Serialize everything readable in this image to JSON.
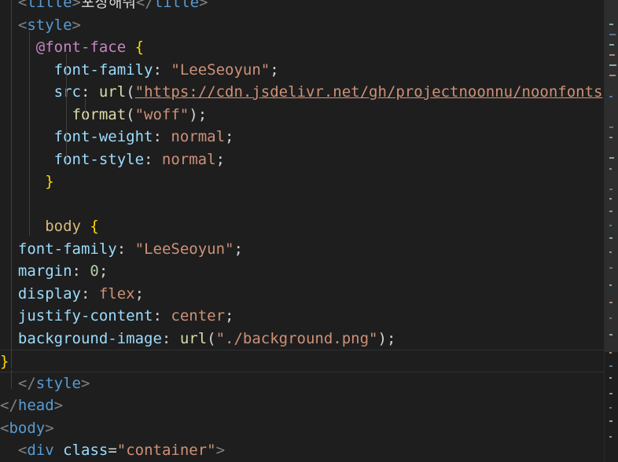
{
  "editor": {
    "lines": [
      {
        "tokens": [
          {
            "t": "  ",
            "c": "punct"
          },
          {
            "t": "<",
            "c": "angle"
          },
          {
            "t": "title",
            "c": "tag"
          },
          {
            "t": ">",
            "c": "angle"
          },
          {
            "t": "포장해줘",
            "c": "punct"
          },
          {
            "t": "</",
            "c": "angle"
          },
          {
            "t": "title",
            "c": "tag"
          },
          {
            "t": ">",
            "c": "angle"
          }
        ]
      },
      {
        "tokens": [
          {
            "t": "  ",
            "c": "punct"
          },
          {
            "t": "<",
            "c": "angle"
          },
          {
            "t": "style",
            "c": "tag"
          },
          {
            "t": ">",
            "c": "angle"
          }
        ]
      },
      {
        "tokens": [
          {
            "t": "    ",
            "c": "punct"
          },
          {
            "t": "@font-face",
            "c": "at"
          },
          {
            "t": " ",
            "c": "punct"
          },
          {
            "t": "{",
            "c": "bracket"
          }
        ]
      },
      {
        "tokens": [
          {
            "t": "      ",
            "c": "punct"
          },
          {
            "t": "font-family",
            "c": "prop"
          },
          {
            "t": ": ",
            "c": "punct"
          },
          {
            "t": "\"LeeSeoyun\"",
            "c": "str"
          },
          {
            "t": ";",
            "c": "punct"
          }
        ]
      },
      {
        "tokens": [
          {
            "t": "      ",
            "c": "punct"
          },
          {
            "t": "src",
            "c": "prop"
          },
          {
            "t": ": ",
            "c": "punct"
          },
          {
            "t": "url",
            "c": "fn"
          },
          {
            "t": "(",
            "c": "punct"
          },
          {
            "t": "\"https://cdn.jsdelivr.net/gh/projectnoonnu/noonfonts",
            "c": "url"
          }
        ]
      },
      {
        "tokens": [
          {
            "t": "        ",
            "c": "punct"
          },
          {
            "t": "format",
            "c": "fn"
          },
          {
            "t": "(",
            "c": "punct"
          },
          {
            "t": "\"woff\"",
            "c": "str"
          },
          {
            "t": ");",
            "c": "punct"
          }
        ]
      },
      {
        "tokens": [
          {
            "t": "      ",
            "c": "punct"
          },
          {
            "t": "font-weight",
            "c": "prop"
          },
          {
            "t": ": ",
            "c": "punct"
          },
          {
            "t": "normal",
            "c": "str"
          },
          {
            "t": ";",
            "c": "punct"
          }
        ]
      },
      {
        "tokens": [
          {
            "t": "      ",
            "c": "punct"
          },
          {
            "t": "font-style",
            "c": "prop"
          },
          {
            "t": ": ",
            "c": "punct"
          },
          {
            "t": "normal",
            "c": "str"
          },
          {
            "t": ";",
            "c": "punct"
          }
        ]
      },
      {
        "tokens": [
          {
            "t": "     ",
            "c": "punct"
          },
          {
            "t": "}",
            "c": "bracket"
          }
        ]
      },
      {
        "tokens": [
          {
            "t": "",
            "c": "punct"
          }
        ]
      },
      {
        "tokens": [
          {
            "t": "     ",
            "c": "punct"
          },
          {
            "t": "body",
            "c": "sel"
          },
          {
            "t": " ",
            "c": "punct"
          },
          {
            "t": "{",
            "c": "bracket"
          }
        ]
      },
      {
        "tokens": [
          {
            "t": "  ",
            "c": "punct"
          },
          {
            "t": "font-family",
            "c": "prop"
          },
          {
            "t": ": ",
            "c": "punct"
          },
          {
            "t": "\"LeeSeoyun\"",
            "c": "str"
          },
          {
            "t": ";",
            "c": "punct"
          }
        ]
      },
      {
        "tokens": [
          {
            "t": "  ",
            "c": "punct"
          },
          {
            "t": "margin",
            "c": "prop"
          },
          {
            "t": ": ",
            "c": "punct"
          },
          {
            "t": "0",
            "c": "num"
          },
          {
            "t": ";",
            "c": "punct"
          }
        ]
      },
      {
        "tokens": [
          {
            "t": "  ",
            "c": "punct"
          },
          {
            "t": "display",
            "c": "prop"
          },
          {
            "t": ": ",
            "c": "punct"
          },
          {
            "t": "flex",
            "c": "str"
          },
          {
            "t": ";",
            "c": "punct"
          }
        ]
      },
      {
        "tokens": [
          {
            "t": "  ",
            "c": "punct"
          },
          {
            "t": "justify-content",
            "c": "prop"
          },
          {
            "t": ": ",
            "c": "punct"
          },
          {
            "t": "center",
            "c": "str"
          },
          {
            "t": ";",
            "c": "punct"
          }
        ]
      },
      {
        "tokens": [
          {
            "t": "  ",
            "c": "punct"
          },
          {
            "t": "background-image",
            "c": "prop"
          },
          {
            "t": ": ",
            "c": "punct"
          },
          {
            "t": "url",
            "c": "fn"
          },
          {
            "t": "(",
            "c": "punct"
          },
          {
            "t": "\"./background.png\"",
            "c": "str"
          },
          {
            "t": ");",
            "c": "punct"
          }
        ]
      },
      {
        "tokens": [
          {
            "t": "}",
            "c": "bracket"
          }
        ]
      },
      {
        "tokens": [
          {
            "t": "  ",
            "c": "punct"
          },
          {
            "t": "</",
            "c": "angle"
          },
          {
            "t": "style",
            "c": "tag"
          },
          {
            "t": ">",
            "c": "angle"
          }
        ]
      },
      {
        "tokens": [
          {
            "t": "</",
            "c": "angle"
          },
          {
            "t": "head",
            "c": "tag"
          },
          {
            "t": ">",
            "c": "angle"
          }
        ]
      },
      {
        "tokens": [
          {
            "t": "<",
            "c": "angle"
          },
          {
            "t": "body",
            "c": "tag"
          },
          {
            "t": ">",
            "c": "angle"
          }
        ]
      },
      {
        "tokens": [
          {
            "t": "  ",
            "c": "punct"
          },
          {
            "t": "<",
            "c": "angle"
          },
          {
            "t": "div",
            "c": "tag"
          },
          {
            "t": " ",
            "c": "punct"
          },
          {
            "t": "class",
            "c": "attr"
          },
          {
            "t": "=",
            "c": "punct"
          },
          {
            "t": "\"container\"",
            "c": "str"
          },
          {
            "t": ">",
            "c": "angle"
          }
        ]
      }
    ],
    "current_line": 16
  }
}
